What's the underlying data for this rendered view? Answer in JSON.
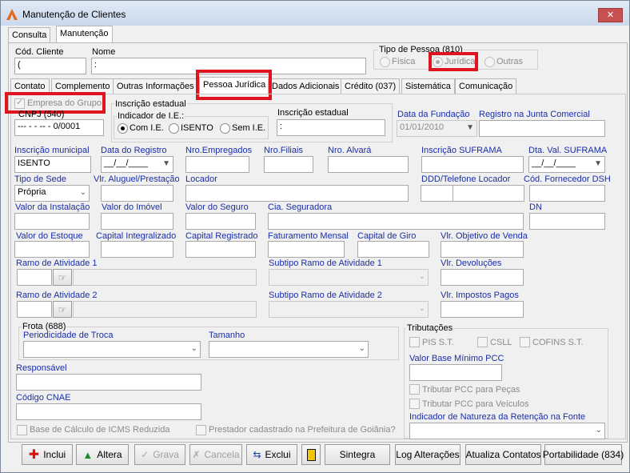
{
  "window": {
    "title": "Manutenção de Clientes",
    "close": "✕"
  },
  "top_tabs": [
    "Consulta",
    "Manutenção"
  ],
  "header": {
    "cod_cliente_label": "Cód. Cliente",
    "cod_cliente_value": "(",
    "nome_label": "Nome",
    "nome_value": ":",
    "tipo_pessoa_label": "Tipo de Pessoa (810)",
    "tipo_options": [
      "Física",
      "Jurídica",
      "Outras"
    ]
  },
  "sub_tabs": [
    "Contato",
    "Complemento",
    "Outras Informações",
    "Pessoa Jurídica",
    "Dados Adicionais",
    "Crédito (037)",
    "Sistemática",
    "Comunicação"
  ],
  "form": {
    "empresa_grupo": "Empresa do Grupo",
    "cnpj_label": "CNPJ (540)",
    "cnpj_value": "--- - - -- - 0/0001",
    "ie_group": "Inscrição estadual",
    "ie_indicator_label": "Indicador de I.E.:",
    "ie_options": [
      "Com I.E.",
      "ISENTO",
      "Sem I.E."
    ],
    "ie_label": "Inscrição estadual",
    "ie_value": ":",
    "data_fundacao_label": "Data da Fundação",
    "data_fundacao_value": "01/01/2010",
    "registro_junta_label": "Registro na Junta Comercial",
    "insc_municipal_label": "Inscrição municipal",
    "insc_municipal_value": "ISENTO",
    "data_registro_label": "Data do Registro",
    "data_registro_value": "__/__/____",
    "nro_empregados_label": "Nro.Empregados",
    "nro_filiais_label": "Nro.Filiais",
    "nro_alvara_label": "Nro. Alvará",
    "insc_suframa_label": "Inscrição SUFRAMA",
    "dta_val_suframa_label": "Dta. Val. SUFRAMA",
    "dta_val_suframa_value": "__/__/____",
    "tipo_sede_label": "Tipo de Sede",
    "tipo_sede_value": "Própria",
    "vlr_aluguel_label": "Vlr. Aluguel/Prestação",
    "locador_label": "Locador",
    "ddd_telefone_label": "DDD/Telefone Locador",
    "cod_fornecedor_label": "Cód. Fornecedor DSH",
    "valor_instalacao_label": "Valor da Instalação",
    "valor_imovel_label": "Valor do Imóvel",
    "valor_seguro_label": "Valor do Seguro",
    "cia_seguradora_label": "Cia. Seguradora",
    "dn_label": "DN",
    "valor_estoque_label": "Valor do Estoque",
    "capital_integralizado_label": "Capital Integralizado",
    "capital_registrado_label": "Capital Registrado",
    "faturamento_label": "Faturamento Mensal",
    "capital_giro_label": "Capital de Giro",
    "vlr_objetivo_label": "Vlr. Objetivo de Venda",
    "ramo1_label": "Ramo de Atividade 1",
    "subtipo1_label": "Subtipo Ramo de Atividade 1",
    "vlr_devolucoes_label": "Vlr. Devoluções",
    "ramo2_label": "Ramo de Atividade 2",
    "subtipo2_label": "Subtipo Ramo de Atividade 2",
    "vlr_impostos_label": "Vlr. Impostos Pagos",
    "frota_label": "Frota (688)",
    "periodicidade_label": "Periodicidade de Troca",
    "tamanho_label": "Tamanho",
    "responsavel_label": "Responsável",
    "cnae_label": "Código CNAE",
    "base_icms_label": "Base de Cálculo de ICMS Reduzida",
    "prestador_label": "Prestador cadastrado na Prefeitura de Goiânia?",
    "tributacoes_label": "Tributações",
    "pis": "PIS S.T.",
    "csll": "CSLL",
    "cofins": "COFINS S.T.",
    "vlr_base_pcc_label": "Valor Base Mínimo PCC",
    "pcc_pecas": "Tributar PCC para Peças",
    "pcc_veiculos": "Tributar PCC para Veículos",
    "indicador_natureza_label": "Indicador de Natureza da Retenção na Fonte"
  },
  "buttons": [
    "Inclui",
    "Altera",
    "Grava",
    "Cancela",
    "Exclui",
    "",
    "Sintegra",
    "Log Alterações",
    "Atualiza Contatos",
    "Portabilidade (834)"
  ]
}
